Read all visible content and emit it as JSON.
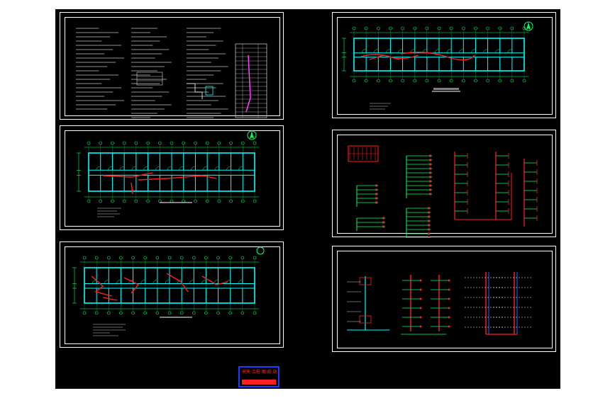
{
  "drawing_set": {
    "background": "#000000",
    "line_color": "#00ff66",
    "wall_color": "#00ffff",
    "pipe_color": "#ff2020",
    "text_color": "#ffffff"
  },
  "sheets": [
    {
      "id": "design-notes",
      "kind": "notes"
    },
    {
      "id": "plan-upper",
      "kind": "floor-plan"
    },
    {
      "id": "plan-ground",
      "kind": "floor-plan"
    },
    {
      "id": "plan-detail",
      "kind": "floor-plan"
    },
    {
      "id": "system-diagram",
      "kind": "riser"
    },
    {
      "id": "riser-diagrams",
      "kind": "riser"
    }
  ],
  "stamp": {
    "line1": "天天 工程 图 纸 站",
    "line2": "",
    "banner": ""
  },
  "north_arrow_icon": "north-arrow-icon"
}
